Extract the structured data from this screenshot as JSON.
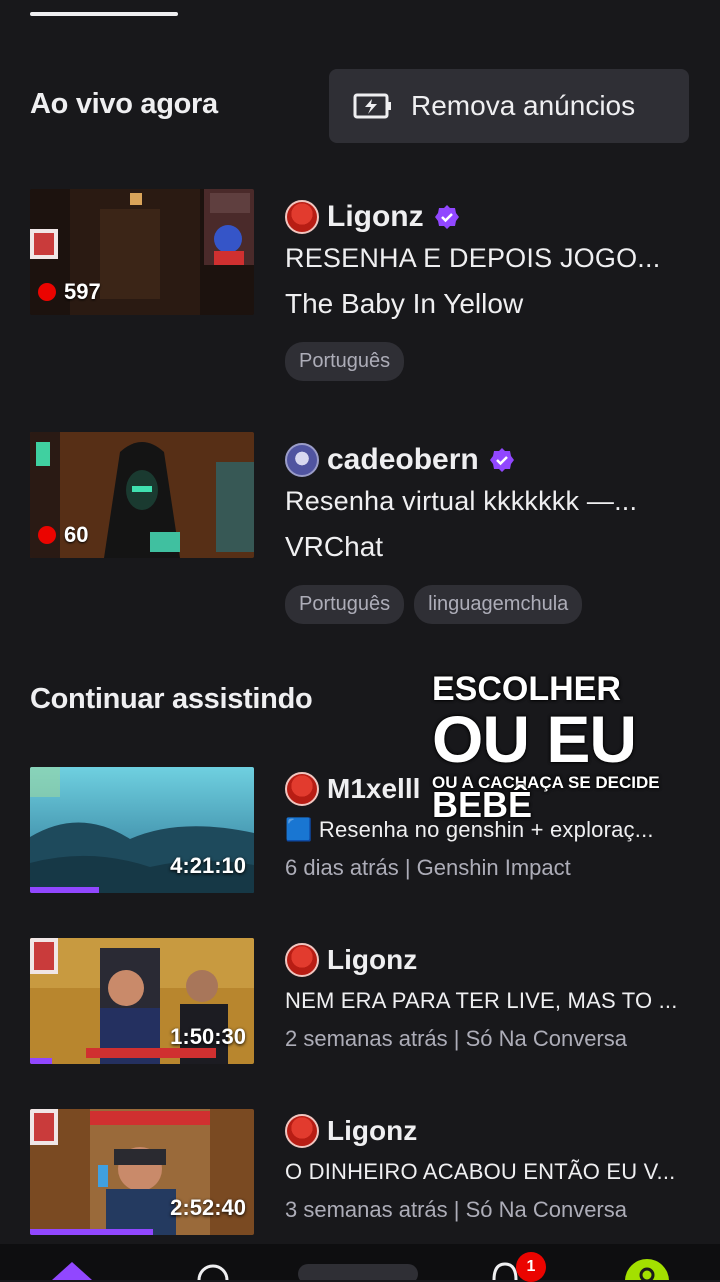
{
  "header": {
    "live_now_title": "Ao vivo agora",
    "remove_ads_label": "Remova anúncios"
  },
  "live": [
    {
      "channel": "Ligonz",
      "verified": true,
      "title": "RESENHA E DEPOIS JOGO...",
      "game": "The Baby In Yellow",
      "viewers": "597",
      "tags": [
        "Português"
      ]
    },
    {
      "channel": "cadeobern",
      "verified": true,
      "title": "Resenha virtual kkkkkkk —...",
      "game": "VRChat",
      "viewers": "60",
      "tags": [
        "Português",
        "linguagemchula"
      ]
    }
  ],
  "continue": {
    "title": "Continuar assistindo",
    "items": [
      {
        "channel": "M1xelll",
        "title": "🟦 Resenha no genshin + exploraç...",
        "subline": "6 dias atrás | Genshin Impact",
        "duration": "4:21:10",
        "progress": 0.31
      },
      {
        "channel": "Ligonz",
        "title": "NEM ERA PARA TER LIVE, MAS TO ...",
        "subline": "2 semanas atrás | Só Na Conversa",
        "duration": "1:50:30",
        "progress": 0.1
      },
      {
        "channel": "Ligonz",
        "title": "O DINHEIRO ACABOU ENTÃO EU V...",
        "subline": "3 semanas atrás | Só Na Conversa",
        "duration": "2:52:40",
        "progress": 0.55
      }
    ]
  },
  "overlay": {
    "line1": "ESCOLHER",
    "line2": "OU EU",
    "line3": "OU A CACHAÇA SE DECIDE",
    "line4": "BEBÊ"
  },
  "nav": {
    "notifications_badge": "1"
  },
  "colors": {
    "background": "#18181b",
    "accent": "#9147ff",
    "live_red": "#eb0400",
    "tag_bg": "#2f2f35"
  }
}
